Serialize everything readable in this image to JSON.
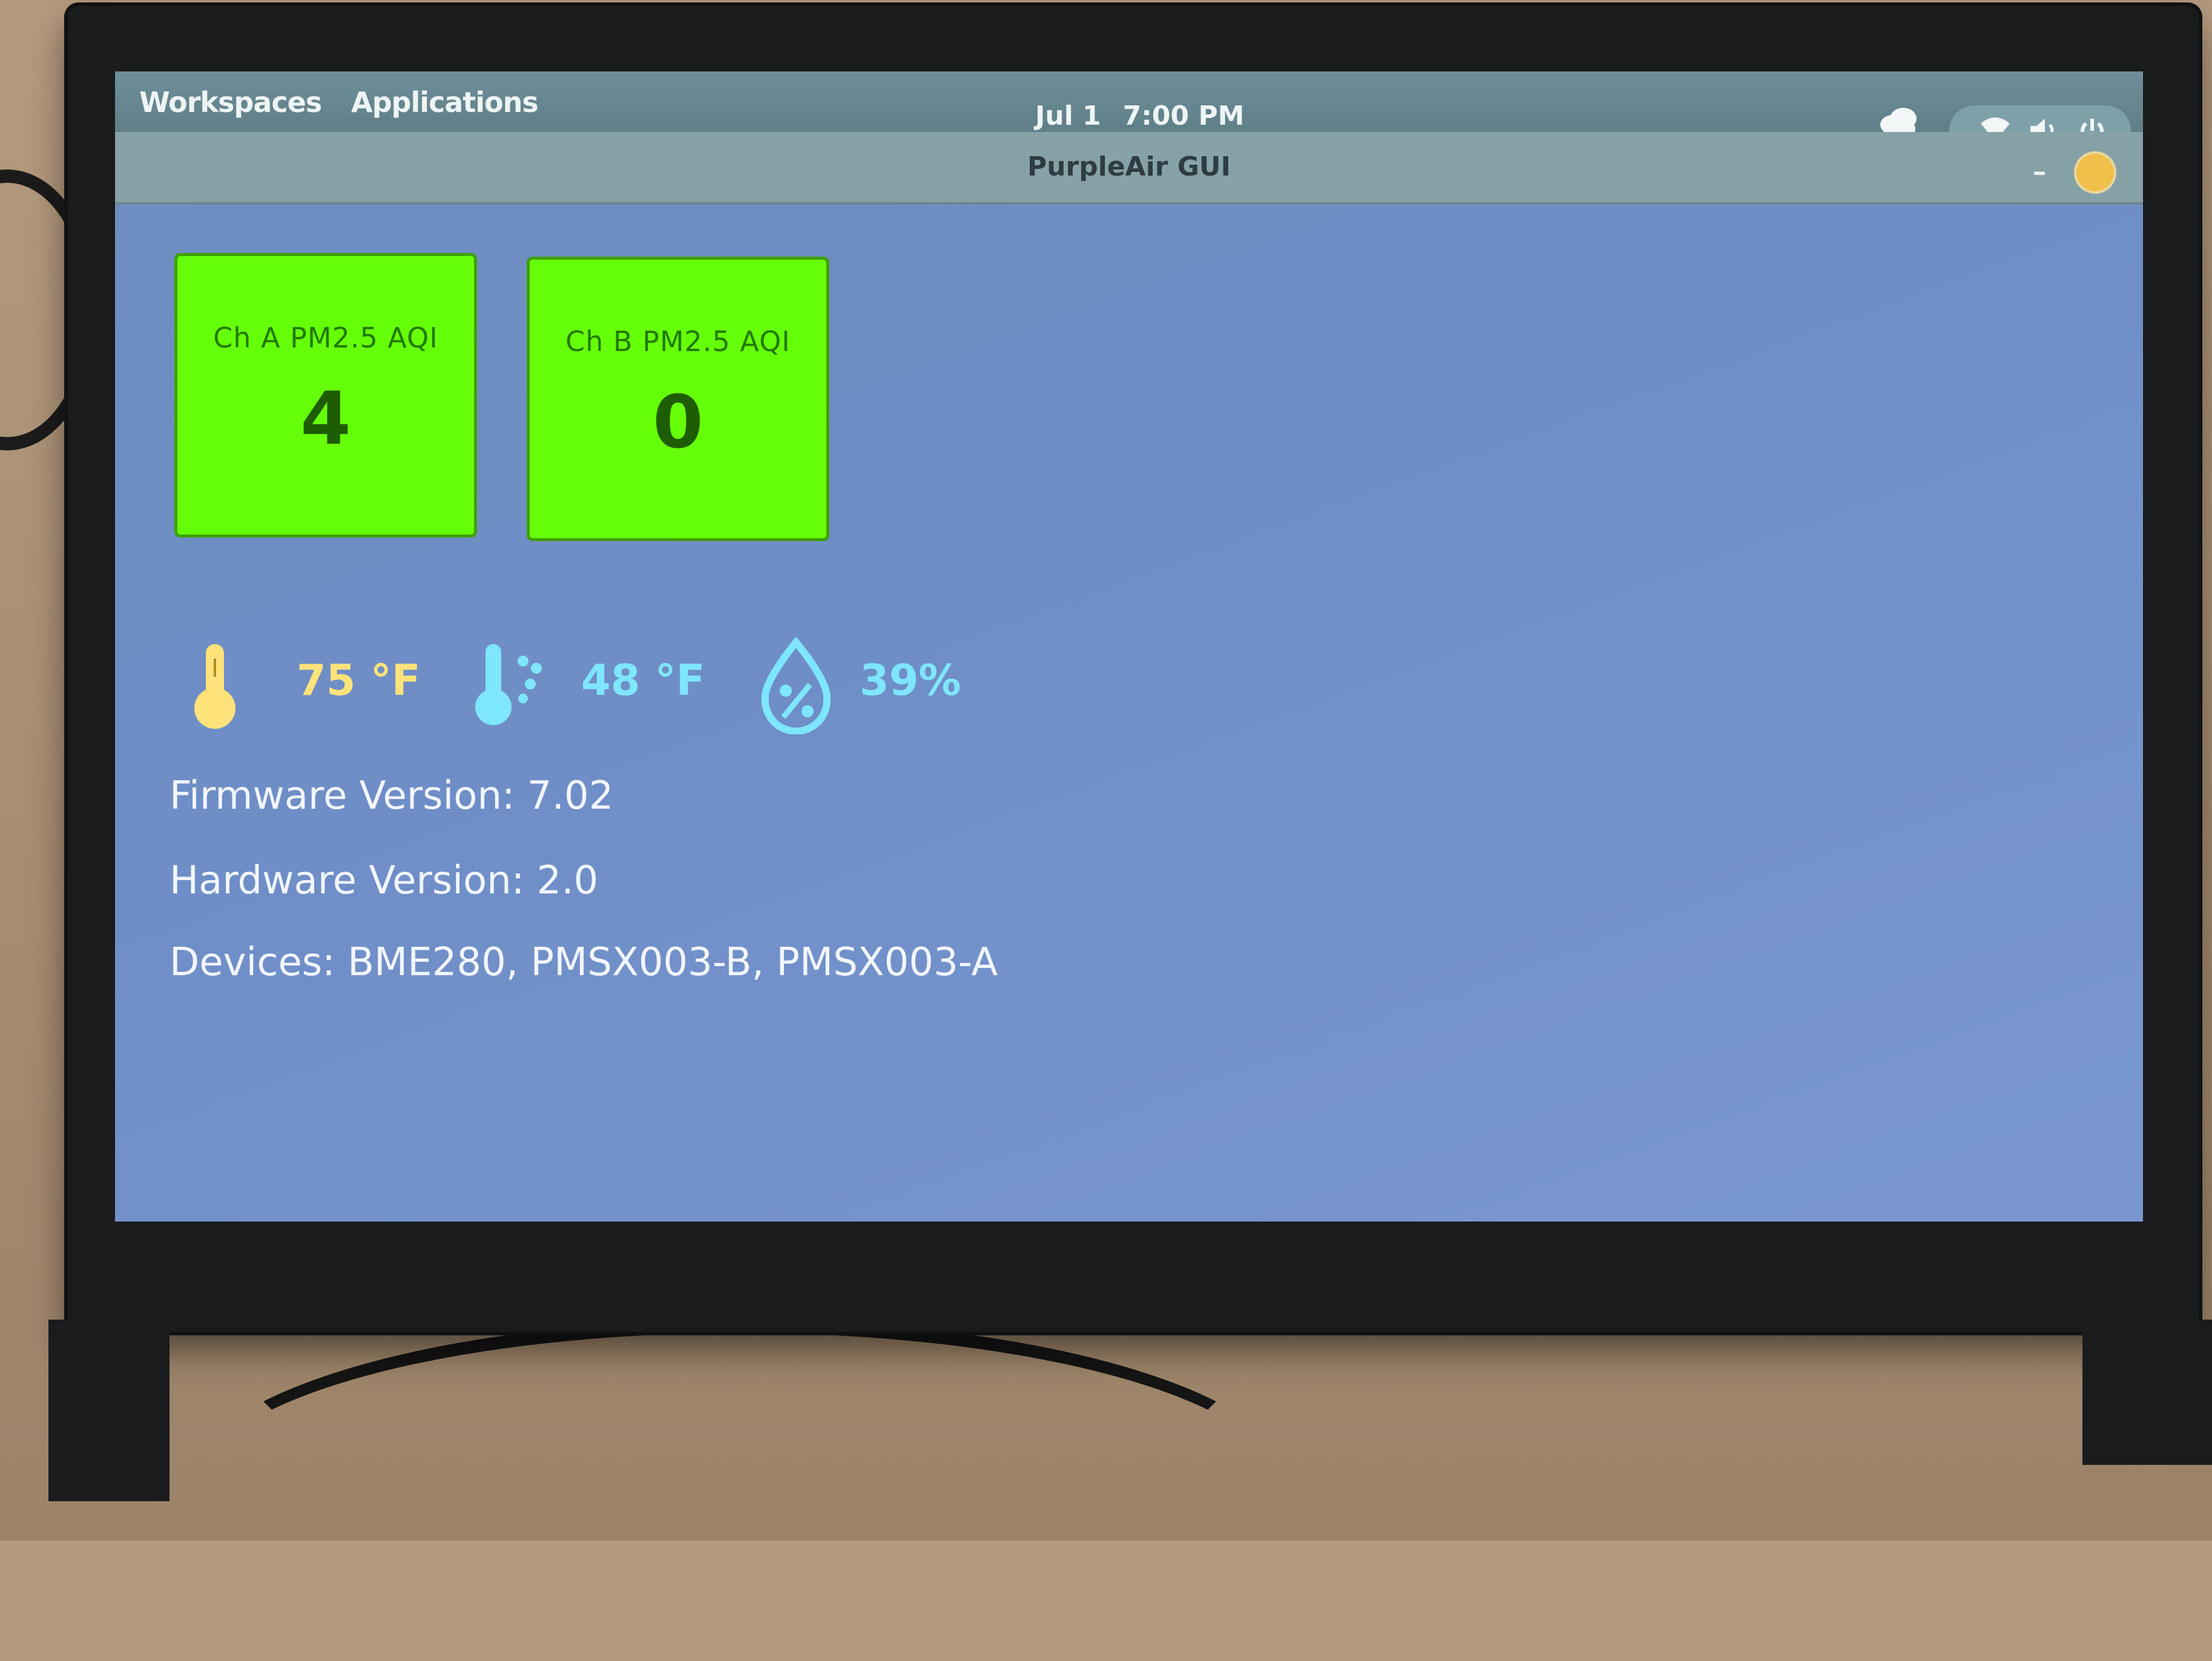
{
  "topbar": {
    "workspaces_label": "Workspaces",
    "applications_label": "Applications",
    "date": "Jul 1",
    "time": "7:00 PM"
  },
  "window": {
    "title": "PurpleAir GUI",
    "minimize_label": "–"
  },
  "aqi_tiles": [
    {
      "label": "Ch A PM2.5 AQI",
      "value": "4"
    },
    {
      "label": "Ch B PM2.5 AQI",
      "value": "0"
    }
  ],
  "readouts": {
    "temperature": "75 °F",
    "dewpoint": "48 °F",
    "humidity": "39%"
  },
  "info": {
    "firmware": "Firmware Version: 7.02",
    "hardware": "Hardware Version: 2.0",
    "devices": "Devices: BME280, PMSX003-B, PMSX003-A"
  },
  "colors": {
    "aqi_good": "#66ff0a",
    "temperature": "#ffe27a",
    "dewpoint": "#7fe6ff",
    "humidity": "#7fe6ff",
    "background": "#6f8ec7"
  },
  "icons": {
    "temperature": "thermometer-icon",
    "dewpoint": "dewpoint-icon",
    "humidity": "humidity-drop-icon",
    "tray": [
      "cloud-icon",
      "wifi-icon",
      "volume-icon",
      "power-icon"
    ]
  }
}
